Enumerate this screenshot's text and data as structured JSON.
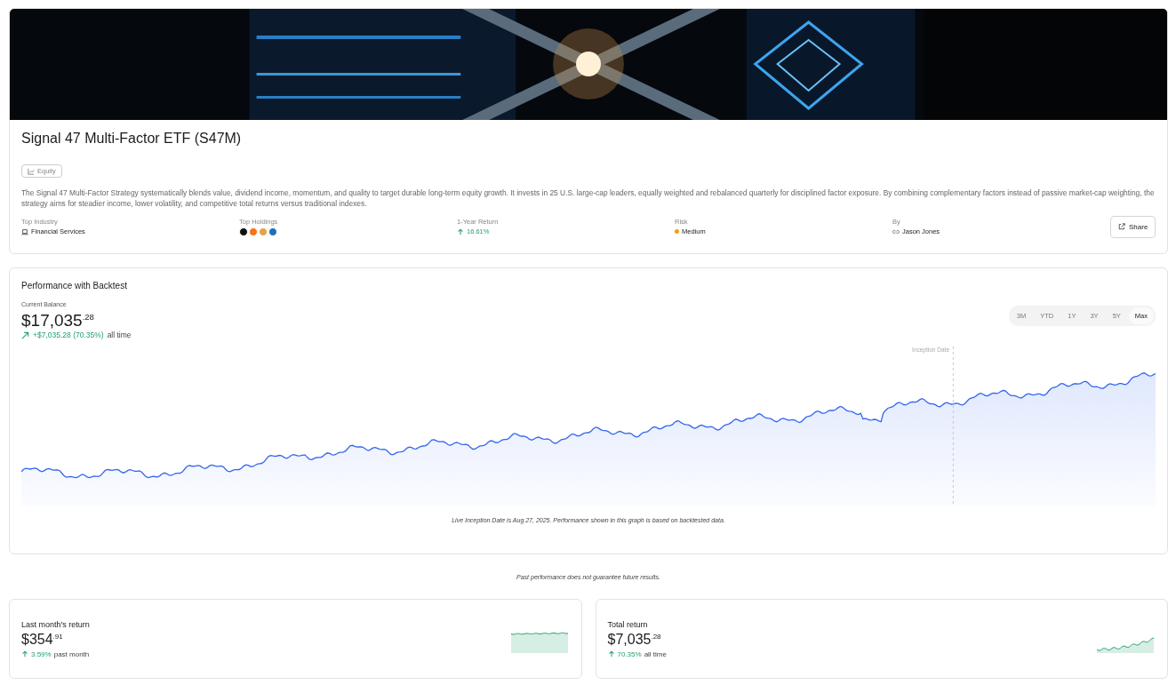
{
  "fund": {
    "title": "Signal 47 Multi-Factor ETF (S47M)",
    "tag": "Equity",
    "description": "The Signal 47 Multi-Factor Strategy systematically blends value, dividend income, momentum, and quality to target durable long-term equity growth. It invests in 25 U.S. large-cap leaders, equally weighted and rebalanced quarterly for disciplined factor exposure. By combining complementary factors instead of passive market-cap weighting, the strategy aims for steadier income, lower volatility, and competitive total returns versus traditional indexes.",
    "meta": [
      {
        "kind": "industry",
        "label": "Top Industry",
        "value": "Financial Services"
      },
      {
        "kind": "holdings",
        "label": "Top Holdings",
        "logos": [
          {
            "color": "#111111"
          },
          {
            "color": "#f97316"
          },
          {
            "color": "#e5a24a"
          },
          {
            "color": "#1d6fb8"
          }
        ]
      },
      {
        "kind": "return",
        "label": "1-Year Return",
        "value": "16.61%"
      },
      {
        "kind": "risk",
        "label": "Risk",
        "value": "Medium",
        "color": "#f59e0b"
      },
      {
        "kind": "author",
        "label": "By",
        "value": "Jason Jones"
      }
    ],
    "share": "Share"
  },
  "performance": {
    "title": "Performance with Backtest",
    "balance_label": "Current Balance",
    "balance": "$17,035",
    "balance_cents": ".28",
    "change": "+$7,035.28 (70.35%)",
    "change_period": "all time",
    "ranges": [
      {
        "label": "3M",
        "selected": false
      },
      {
        "label": "YTD",
        "selected": false
      },
      {
        "label": "1Y",
        "selected": false
      },
      {
        "label": "3Y",
        "selected": false
      },
      {
        "label": "5Y",
        "selected": false
      },
      {
        "label": "Max",
        "selected": true
      }
    ],
    "inception_label": "Inception Date",
    "note": "Live Inception Date is Aug 27, 2025. Performance shown in this graph is based on backtested data."
  },
  "disclaimer": "Past performance does not guarantee future results.",
  "stats": [
    {
      "title": "Last month's return",
      "amount": "$354",
      "cents": ".91",
      "change": "3.59%",
      "period": "past month"
    },
    {
      "title": "Total return",
      "amount": "$7,035",
      "cents": ".28",
      "change": "70.35%",
      "period": "all time"
    }
  ]
}
